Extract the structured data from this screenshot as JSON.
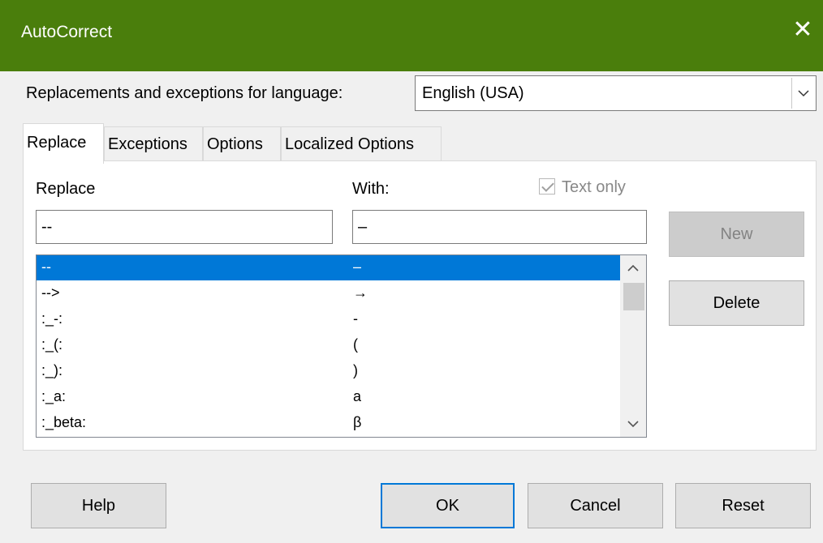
{
  "window": {
    "title": "AutoCorrect",
    "close_glyph": "✕"
  },
  "language": {
    "label": "Replacements and exceptions for language:",
    "value": "English (USA)"
  },
  "tabs": [
    {
      "label": "Replace",
      "active": true
    },
    {
      "label": "Exceptions",
      "active": false
    },
    {
      "label": "Options",
      "active": false
    },
    {
      "label": "Localized Options",
      "active": false
    }
  ],
  "replace_panel": {
    "replace_label": "Replace",
    "with_label": "With:",
    "text_only_label": "Text only",
    "text_only_checked": true,
    "replace_value": "--",
    "with_value": "–",
    "rows": [
      {
        "replace": "--",
        "with": "–",
        "selected": true
      },
      {
        "replace": "-->",
        "with": "→",
        "selected": false
      },
      {
        "replace": ":_-:",
        "with": "-",
        "selected": false
      },
      {
        "replace": ":_(:",
        "with": "(",
        "selected": false
      },
      {
        "replace": ":_):",
        "with": ")",
        "selected": false
      },
      {
        "replace": ":_a:",
        "with": "a",
        "selected": false
      },
      {
        "replace": ":_beta:",
        "with": "β",
        "selected": false
      }
    ],
    "new_button": "New",
    "delete_button": "Delete"
  },
  "footer": {
    "help": "Help",
    "ok": "OK",
    "cancel": "Cancel",
    "reset": "Reset"
  },
  "colors": {
    "titlebar": "#4a7e0c",
    "selection": "#0078d7"
  },
  "icons": [
    "close-icon",
    "chevron-down-icon",
    "scroll-up-icon",
    "scroll-down-icon",
    "checkbox-checked-icon"
  ]
}
